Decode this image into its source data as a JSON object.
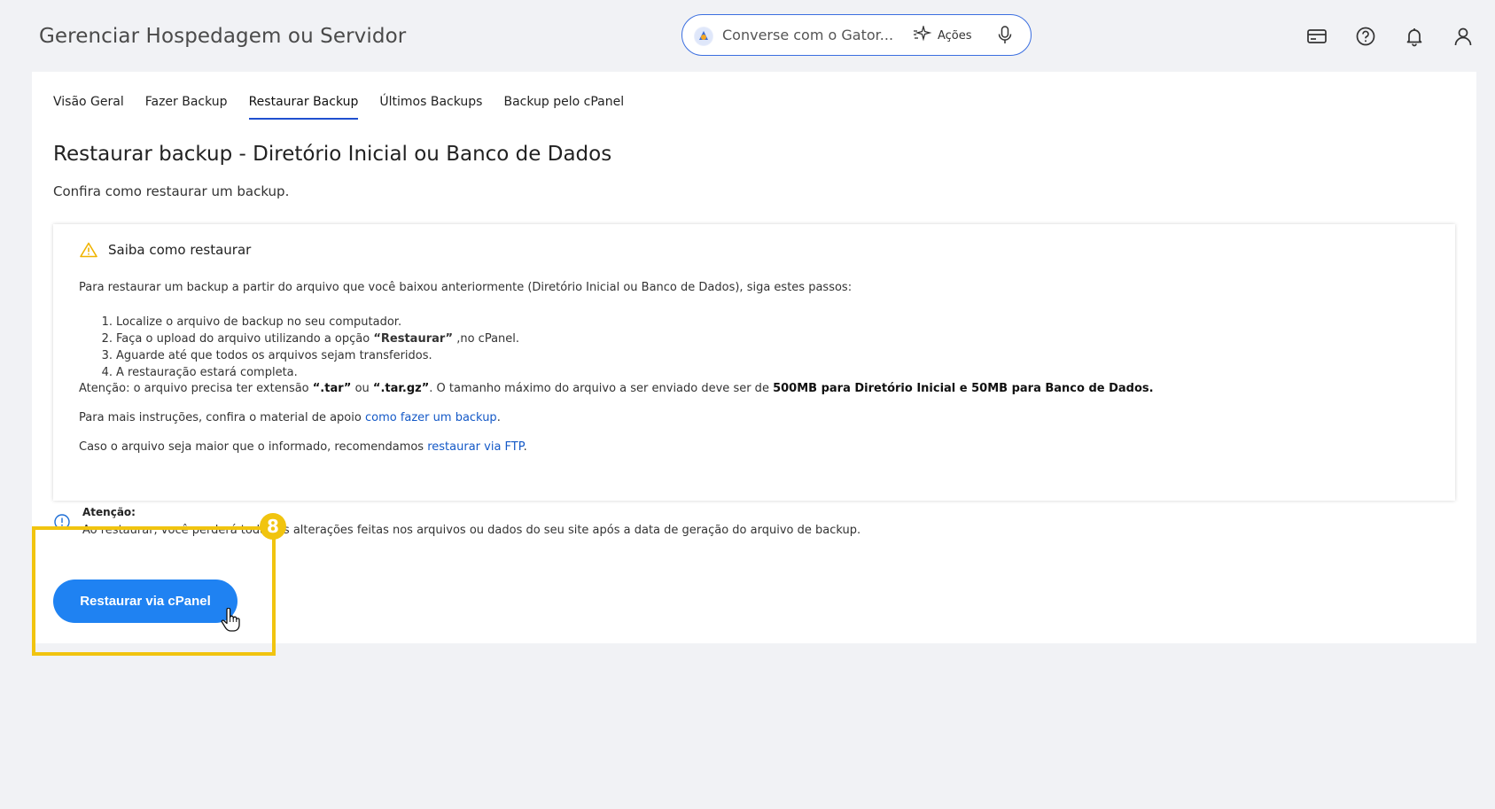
{
  "header": {
    "title": "Gerenciar Hospedagem ou Servidor",
    "chat": {
      "placeholder": "Converse com o Gator...",
      "actions_label": "Ações",
      "avatar_icon": "gator-avatar-icon",
      "actions_icon": "sparkle-icon",
      "mic_icon": "microphone-icon"
    },
    "icons": [
      "card-icon",
      "help-icon",
      "bell-icon",
      "user-icon"
    ]
  },
  "tabs": [
    {
      "label": "Visão Geral",
      "active": false
    },
    {
      "label": "Fazer Backup",
      "active": false
    },
    {
      "label": "Restaurar Backup",
      "active": true
    },
    {
      "label": "Últimos Backups",
      "active": false
    },
    {
      "label": "Backup pelo cPanel",
      "active": false
    }
  ],
  "main": {
    "title": "Restaurar backup - Diretório Inicial ou Banco de Dados",
    "subtitle": "Confira como restaurar um backup."
  },
  "card": {
    "heading": "Saiba como restaurar",
    "intro": "Para restaurar um backup a partir do arquivo que você baixou anteriormente (Diretório Inicial ou Banco de Dados), siga estes passos:",
    "steps": [
      {
        "num": "1.",
        "text": "Localize o arquivo de backup no seu computador."
      },
      {
        "num": "2.",
        "text_before": "Faça o upload do arquivo utilizando a opção ",
        "bold": "“Restaurar”",
        "text_after": " ,no cPanel."
      },
      {
        "num": "3.",
        "text": "Aguarde até que todos os arquivos sejam transferidos."
      },
      {
        "num": "4.",
        "text": "A restauração estará completa."
      }
    ],
    "attention": {
      "p1": "Atenção: o arquivo precisa ter extensão ",
      "ext1": "“.tar”",
      "p2": " ou ",
      "ext2": "“.tar.gz”",
      "p3": ". O tamanho máximo do arquivo a ser enviado deve ser de ",
      "limit": "500MB para Diretório Inicial e 50MB para Banco de Dados."
    },
    "instructions": {
      "prefix": "Para mais instruções, confira o material de apoio ",
      "link": "como fazer um backup",
      "suffix": "."
    },
    "ftp": {
      "prefix": "Caso o arquivo seja maior que o informado, recomendamos ",
      "link": "restaurar via FTP",
      "suffix": "."
    }
  },
  "notice": {
    "title": "Atenção:",
    "text": "Ao restaurar, você perderá todas as alterações feitas nos arquivos ou dados do seu site após a data de geração do arquivo de backup."
  },
  "button": {
    "label": "Restaurar via cPanel"
  },
  "tutorial": {
    "step": "8"
  },
  "colors": {
    "accent": "#1f82f2",
    "link": "#1459c7",
    "highlight": "#f1c40f",
    "warning": "#f0b400",
    "tab_underline": "#1f4fcf"
  }
}
